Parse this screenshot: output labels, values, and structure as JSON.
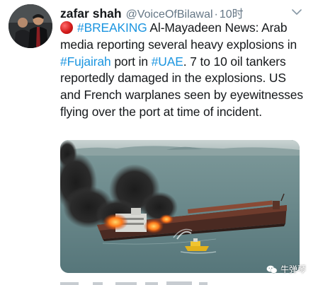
{
  "tweet": {
    "display_name": "zafar shah",
    "handle": "@VoiceOfBilawal",
    "separator": "·",
    "time": "10时",
    "text_parts": {
      "hashtag_breaking": "#BREAKING",
      "text_1": " Al-Mayadeen News: Arab media reporting several heavy explosions in ",
      "hashtag_fujairah": "#Fujairah",
      "text_2": " port in ",
      "hashtag_uae": "#UAE",
      "text_3": ". 7 to 10 oil tankers reportedly damaged in the explosions. US and French warplanes seen by eyewitnesses flying over the port at time of incident."
    }
  },
  "watermark": {
    "text": "牛弹琴"
  },
  "icons": {
    "more": "chevron-down-icon",
    "red_circle": "red-circle-emoji",
    "watermark": "wechat-icon"
  },
  "colors": {
    "link": "#1b95e0",
    "secondary_text": "#657786",
    "primary_text": "#14171a"
  }
}
